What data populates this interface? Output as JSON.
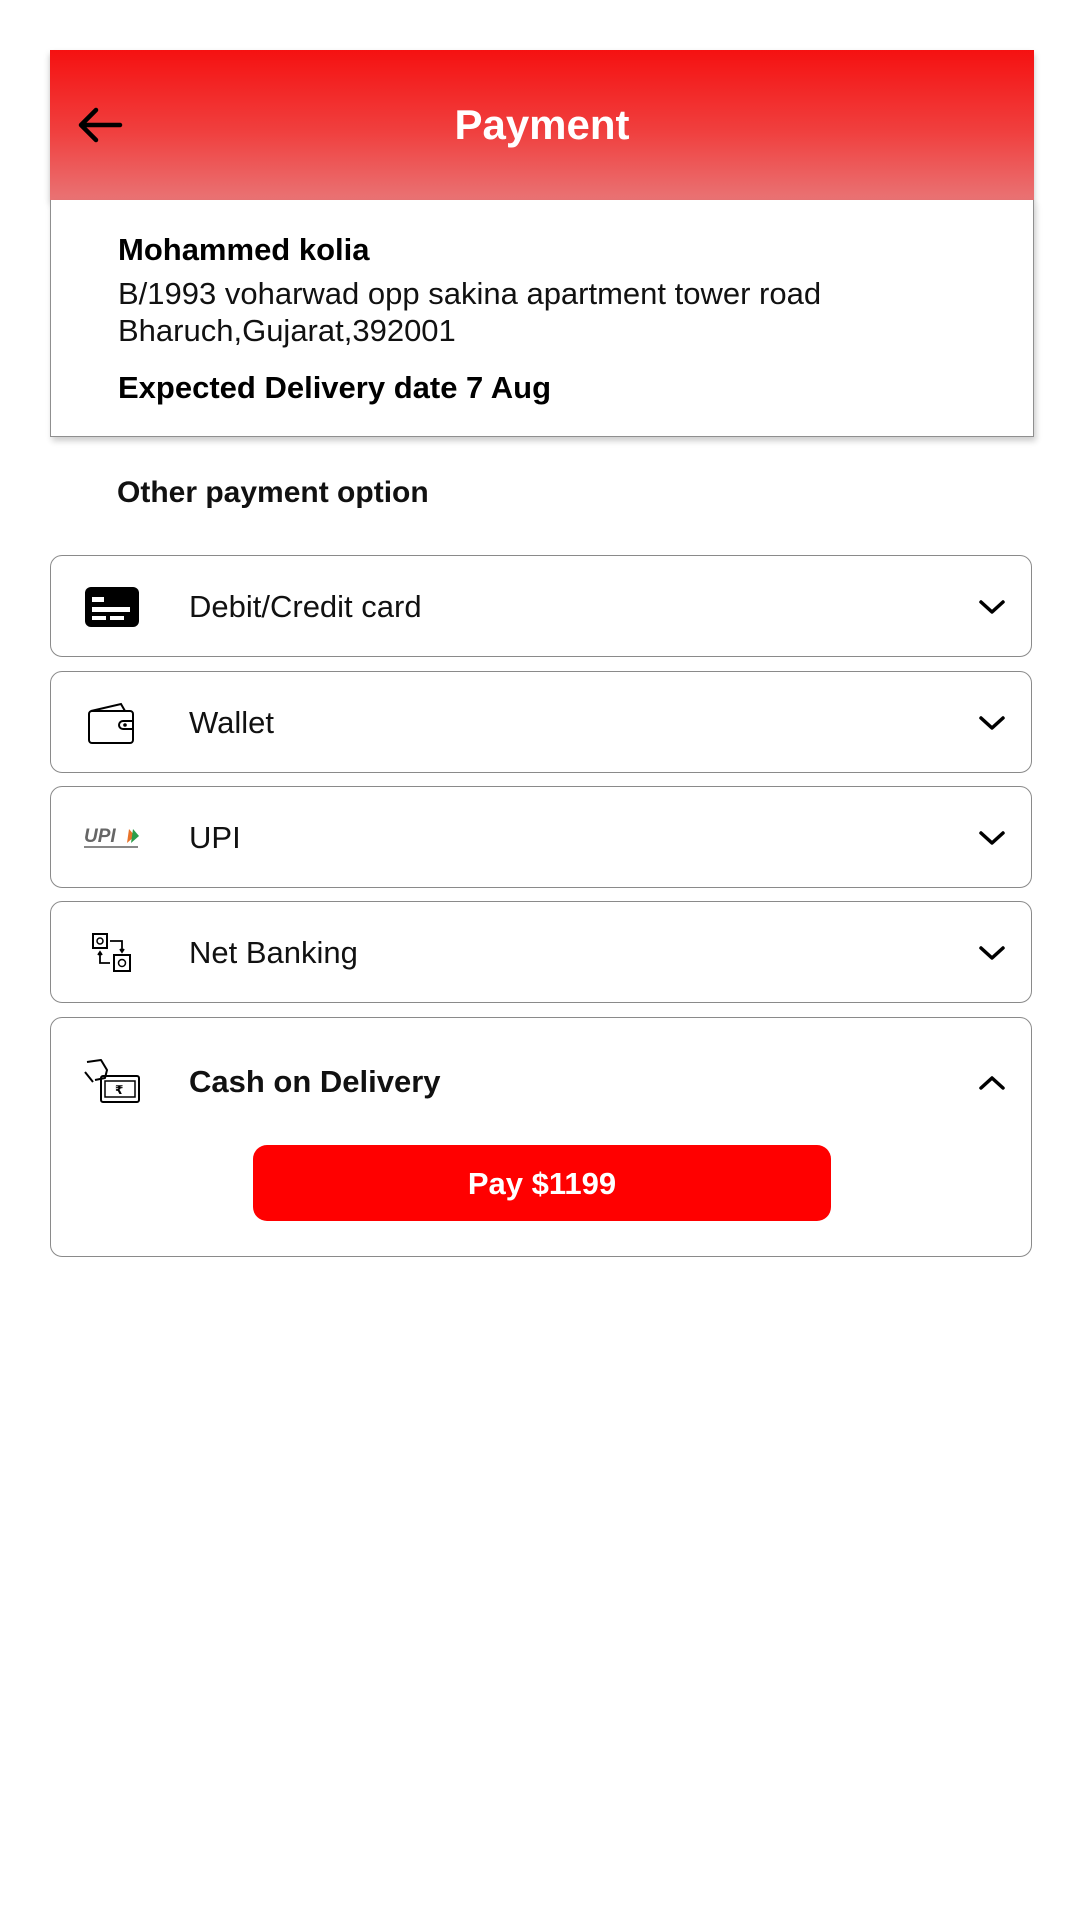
{
  "header": {
    "title": "Payment"
  },
  "address": {
    "name": "Mohammed kolia",
    "line1": "B/1993 voharwad opp sakina apartment tower road",
    "line2": "Bharuch,Gujarat,392001",
    "delivery": "Expected Delivery date 7 Aug"
  },
  "payment": {
    "section_title": "Other payment option",
    "options": [
      {
        "label": "Debit/Credit card",
        "icon": "credit-card-icon",
        "expanded": false
      },
      {
        "label": "Wallet",
        "icon": "wallet-icon",
        "expanded": false
      },
      {
        "label": "UPI",
        "icon": "upi-logo-icon",
        "expanded": false
      },
      {
        "label": "Net Banking",
        "icon": "net-banking-icon",
        "expanded": false
      },
      {
        "label": "Cash on Delivery",
        "icon": "cash-payment-icon",
        "expanded": true
      }
    ],
    "pay_button": "Pay $1199"
  },
  "colors": {
    "header_top": "#f51111",
    "header_bottom": "#e97374",
    "pay_button": "#ff0000"
  }
}
